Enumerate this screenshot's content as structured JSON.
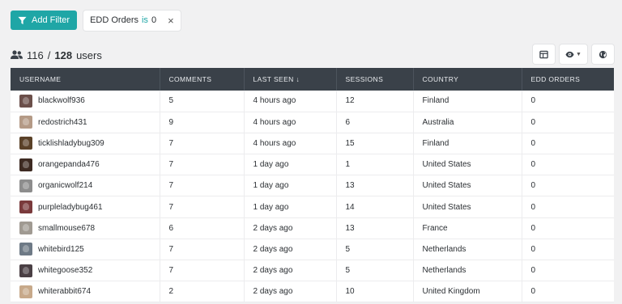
{
  "filter_bar": {
    "add_filter_label": "Add Filter",
    "chip": {
      "field": "EDD Orders",
      "operator": "is",
      "value": "0",
      "close": "×"
    }
  },
  "summary": {
    "shown": "116",
    "separator": "/",
    "total": "128",
    "unit": "users"
  },
  "tools": {
    "table_icon": "table-icon",
    "view_icon": "eye-icon",
    "map_icon": "globe-icon"
  },
  "table": {
    "headers": [
      "USERNAME",
      "COMMENTS",
      "LAST SEEN ↓",
      "SESSIONS",
      "COUNTRY",
      "EDD ORDERS"
    ],
    "rows": [
      {
        "username": "blackwolf936",
        "comments": "5",
        "last_seen": "4 hours ago",
        "sessions": "12",
        "country": "Finland",
        "edd_orders": "0",
        "avatar_color": "#6b4f4a"
      },
      {
        "username": "redostrich431",
        "comments": "9",
        "last_seen": "4 hours ago",
        "sessions": "6",
        "country": "Australia",
        "edd_orders": "0",
        "avatar_color": "#b49a86"
      },
      {
        "username": "ticklishladybug309",
        "comments": "7",
        "last_seen": "4 hours ago",
        "sessions": "15",
        "country": "Finland",
        "edd_orders": "0",
        "avatar_color": "#5a4128"
      },
      {
        "username": "orangepanda476",
        "comments": "7",
        "last_seen": "1 day ago",
        "sessions": "1",
        "country": "United States",
        "edd_orders": "0",
        "avatar_color": "#3d2a22"
      },
      {
        "username": "organicwolf214",
        "comments": "7",
        "last_seen": "1 day ago",
        "sessions": "13",
        "country": "United States",
        "edd_orders": "0",
        "avatar_color": "#8d8d8d"
      },
      {
        "username": "purpleladybug461",
        "comments": "7",
        "last_seen": "1 day ago",
        "sessions": "14",
        "country": "United States",
        "edd_orders": "0",
        "avatar_color": "#7a3a3c"
      },
      {
        "username": "smallmouse678",
        "comments": "6",
        "last_seen": "2 days ago",
        "sessions": "13",
        "country": "France",
        "edd_orders": "0",
        "avatar_color": "#a09a92"
      },
      {
        "username": "whitebird125",
        "comments": "7",
        "last_seen": "2 days ago",
        "sessions": "5",
        "country": "Netherlands",
        "edd_orders": "0",
        "avatar_color": "#6e7a86"
      },
      {
        "username": "whitegoose352",
        "comments": "7",
        "last_seen": "2 days ago",
        "sessions": "5",
        "country": "Netherlands",
        "edd_orders": "0",
        "avatar_color": "#4a3f44"
      },
      {
        "username": "whiterabbit674",
        "comments": "2",
        "last_seen": "2 days ago",
        "sessions": "10",
        "country": "United Kingdom",
        "edd_orders": "0",
        "avatar_color": "#c7a98a"
      }
    ]
  },
  "colors": {
    "accent": "#1fa6a6",
    "header_bg": "#3a4149",
    "page_bg": "#f1f1f2"
  }
}
